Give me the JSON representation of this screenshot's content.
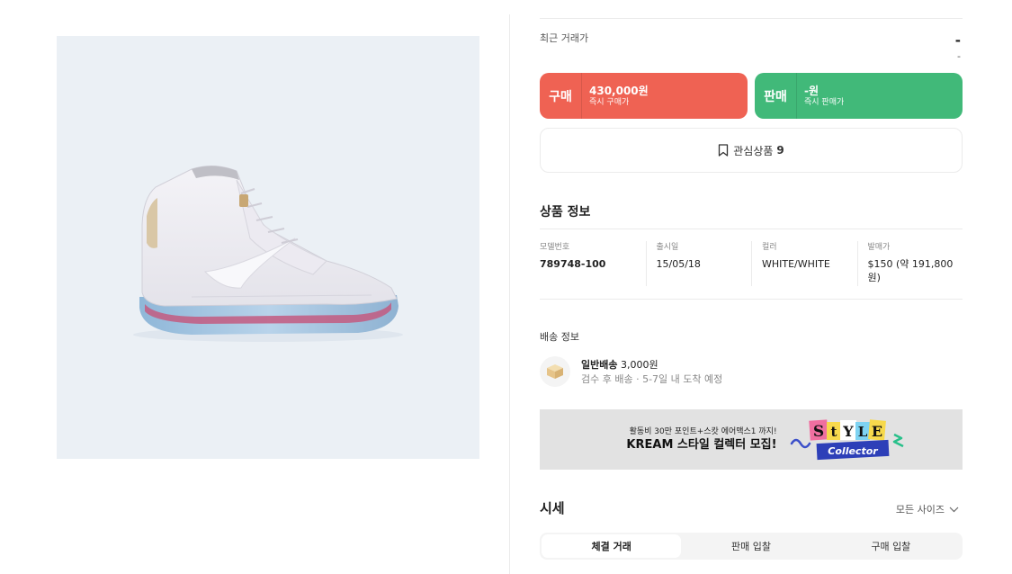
{
  "recent": {
    "label": "최근 거래가",
    "value": "-",
    "diff": "-"
  },
  "buy": {
    "title": "구매",
    "price": "430,000원",
    "sub": "즉시 구매가"
  },
  "sell": {
    "title": "판매",
    "price": "-원",
    "sub": "즉시 판매가"
  },
  "wish": {
    "label": "관심상품",
    "count": "9"
  },
  "product_info": {
    "title": "상품 정보",
    "fields": [
      {
        "label": "모델번호",
        "value": "789748-100"
      },
      {
        "label": "출시일",
        "value": "15/05/18"
      },
      {
        "label": "컬러",
        "value": "WHITE/WHITE"
      },
      {
        "label": "발매가",
        "value": "$150 (약 191,800원)"
      }
    ]
  },
  "shipping": {
    "title": "배송 정보",
    "method": "일반배송",
    "fee": "3,000원",
    "detail": "검수 후 배송 · 5-7일 내 도착 예정"
  },
  "banner": {
    "sub": "활동비 30만 포인트+스캇 에어맥스1 까지!",
    "main": "KREAM 스타일 컬렉터 모집!",
    "logo_top": "StYLE",
    "logo_bottom": "Collector"
  },
  "market": {
    "title": "시세",
    "size_select": "모든 사이즈",
    "tabs": [
      "체결 거래",
      "판매 입찰",
      "구매 입찰"
    ]
  },
  "colors": {
    "buy": "#ef6253",
    "sell": "#41b979",
    "image_bg": "#ebf0f5"
  }
}
